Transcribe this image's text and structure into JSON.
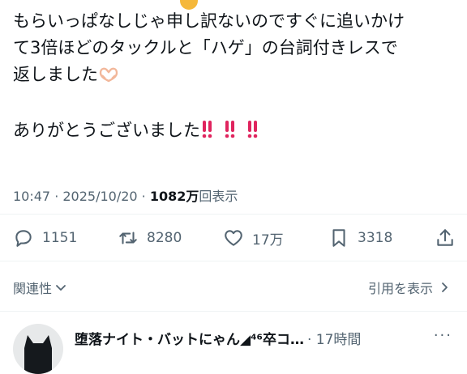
{
  "tweet": {
    "lines": [
      "もらいっぱなしじゃ申し訳ないのですぐに追いかけ",
      "て3倍ほどのタックルと「ハゲ」の台詞付きレスで",
      "返しました"
    ],
    "thanks": "ありがとうございました",
    "meta": {
      "time": "10:47",
      "separator1": " · ",
      "date": "2025/10/20",
      "separator2": " · ",
      "views_count": "1082万",
      "views_label": "回表示"
    }
  },
  "actions": {
    "replies": "1151",
    "reposts": "8280",
    "likes": "17万",
    "bookmarks": "3318"
  },
  "links": {
    "related": "関連性",
    "quotes": "引用を表示"
  },
  "reply": {
    "name": "堕落ナイト・バットにゃん◢⁴⁶卒コ…",
    "time": "· 17時間",
    "more": "···"
  },
  "colors": {
    "text": "#0f1419",
    "secondary": "#536471",
    "divider": "#eff3f4",
    "emoji_red": "#e0245e"
  }
}
